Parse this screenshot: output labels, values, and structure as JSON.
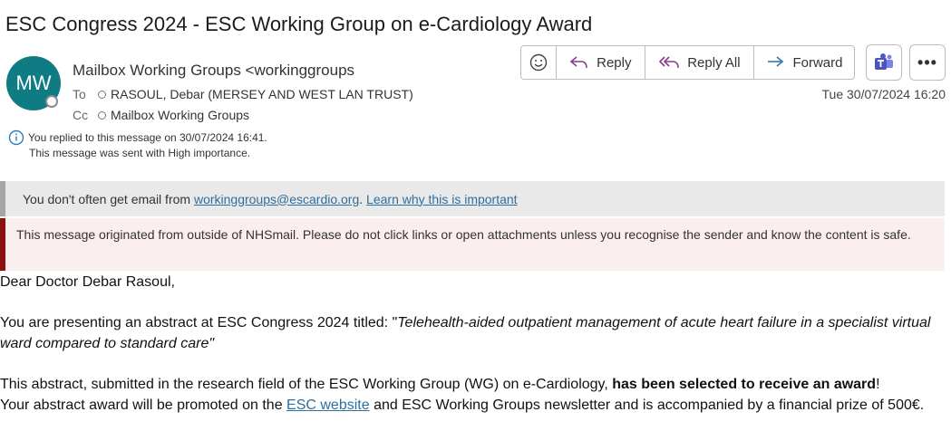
{
  "email": {
    "subject": "ESC Congress 2024 - ESC Working Group on e-Cardiology Award",
    "avatar_initials": "MW",
    "from": "Mailbox Working Groups <workinggroups",
    "to_label": "To",
    "to_value": "RASOUL, Debar (MERSEY AND WEST LAN                    TRUST)",
    "cc_label": "Cc",
    "cc_value": "Mailbox Working Groups",
    "date": "Tue 30/07/2024 16:20",
    "replied_notice": "You replied to this message on 30/07/2024 16:41.",
    "importance_notice": "This message was sent with High importance."
  },
  "toolbar": {
    "reply_label": "Reply",
    "reply_all_label": "Reply All",
    "forward_label": "Forward",
    "icons": [
      "emoji-icon",
      "reply-icon",
      "reply-all-icon",
      "forward-icon",
      "teams-icon",
      "more-icon"
    ],
    "more_label": "•••"
  },
  "banners": {
    "sender_prefix": "You don't often get email from ",
    "sender_email": "workinggroups@escardio.org",
    "sender_sep": ". ",
    "learn_link": "Learn why this is important",
    "external_warning": "This message originated from outside of NHSmail. Please do not click links or open attachments unless you recognise the sender and know the content is safe."
  },
  "body": {
    "greeting": "Dear Doctor Debar Rasoul,",
    "p1_prefix": "You are presenting an abstract at ESC Congress 2024 titled: \"",
    "p1_title": "Telehealth-aided outpatient management of acute heart failure in a specialist virtual ward compared to standard care",
    "p1_suffix": "\"",
    "p2_prefix": "This abstract, submitted in the research field of the ESC Working Group (WG) on e-Cardiology, ",
    "p2_bold": "has been selected to receive an award",
    "p2_suffix": "!",
    "p3_prefix": "Your abstract award will be promoted on the ",
    "p3_link": "ESC website",
    "p3_suffix": " and ESC Working Groups newsletter and is accompanied by a financial prize of 500€."
  },
  "colors": {
    "avatar": "#0f7b82",
    "external_bar": "#8b1111",
    "link": "#2e6f9e",
    "teams": "#5059c9"
  }
}
